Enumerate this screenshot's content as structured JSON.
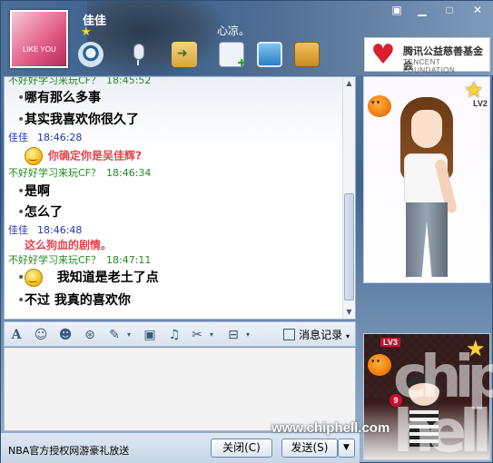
{
  "window": {
    "contact_name": "佳佳",
    "signature": "心凉。",
    "avatar_caption": "LIKE YOU",
    "controls": {
      "skin": "▣",
      "minimize": "▁",
      "maximize": "□",
      "close": "✕"
    }
  },
  "toolbar": {
    "items": [
      "video-call",
      "voice-call",
      "send-file",
      "apps",
      "remote-assist",
      "notes"
    ]
  },
  "banner": {
    "cn": "腾讯公益慈善基金会",
    "en": "TENCENT FOUNDATION"
  },
  "chat": {
    "messages": [
      {
        "sender": "不好好学习来玩CF？",
        "time": "18:45:52"
      },
      {
        "text": "哪有那么多事"
      },
      {
        "text": "其实我喜欢你很久了"
      },
      {
        "sender": "佳佳",
        "time": "18:46:28"
      },
      {
        "text": "你确定你是吴佳辉?"
      },
      {
        "sender": "不好好学习来玩CF？",
        "time": "18:46:34"
      },
      {
        "text": "是啊"
      },
      {
        "text": "怎么了"
      },
      {
        "sender": "佳佳",
        "time": "18:46:48"
      },
      {
        "text": "这么狗血的剧情。"
      },
      {
        "sender": "不好好学习来玩CF？",
        "time": "18:47:11"
      },
      {
        "text": "我知道是老土了点"
      },
      {
        "text": "不过  我真的喜欢你"
      }
    ]
  },
  "input_toolbar": {
    "icons": [
      "font-icon",
      "emoticon-icon",
      "magic-emoticon-icon",
      "shake-icon",
      "doodle-icon",
      "image-icon",
      "music-icon",
      "screenshot-icon",
      "more-icon"
    ],
    "history_label": "消息记录"
  },
  "footer": {
    "ad_text": "NBA官方授权网游豪礼放送",
    "close_label": "关闭(C)",
    "send_label": "发送(S)",
    "send_arrow": "▼"
  },
  "show_panel": {
    "top_level": "LV2",
    "bottom_level": "LV3",
    "bottom_badge": "9"
  },
  "watermark": {
    "big_text": "chip hell",
    "url": "www.chiphell.com"
  }
}
